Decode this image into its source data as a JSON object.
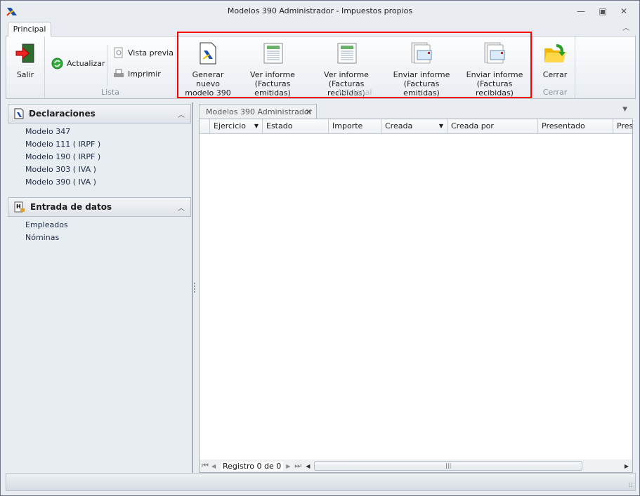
{
  "window": {
    "title": "Modelos 390 Administrador - Impuestos propios",
    "minimize": "—",
    "restore": "▣",
    "close": "✕",
    "collapse_ribbon": "︿"
  },
  "ribbon": {
    "tab": "Principal",
    "salir": "Salir",
    "actualizar": "Actualizar",
    "vista_previa": "Vista previa",
    "imprimir": "Imprimir",
    "lista_label": "Lista",
    "adicional_label": "Adicional",
    "cerrar_label": "Cerrar",
    "generar": [
      "Generar nuevo",
      "modelo 390"
    ],
    "ver_emitidas": [
      "Ver informe",
      "(Facturas emitidas)"
    ],
    "ver_recibidas": [
      "Ver informe",
      "(Facturas recibidas)"
    ],
    "enviar_emitidas": [
      "Enviar informe",
      "(Facturas emitidas)"
    ],
    "enviar_recibidas": [
      "Enviar informe",
      "(Facturas recibidas)"
    ],
    "cerrar": "Cerrar"
  },
  "sidebar": {
    "groups": [
      {
        "title": "Declaraciones",
        "items": [
          "Modelo 347",
          "Modelo 111 ( IRPF )",
          "Modelo 190 ( IRPF )",
          "Modelo 303 ( IVA )",
          "Modelo 390 ( IVA )"
        ]
      },
      {
        "title": "Entrada de datos",
        "items": [
          "Empleados",
          "Nóminas"
        ]
      }
    ]
  },
  "document": {
    "tab": "Modelos 390 Administrador",
    "close": "✕",
    "menu": "▼",
    "columns": [
      "Ejercicio",
      "Estado",
      "Importe",
      "Creada",
      "Creada por",
      "Presentado",
      "Prese"
    ],
    "record_text": "Registro 0 de 0"
  },
  "colors": {
    "highlight": "#ff0000",
    "panel": "#e8edf2"
  }
}
